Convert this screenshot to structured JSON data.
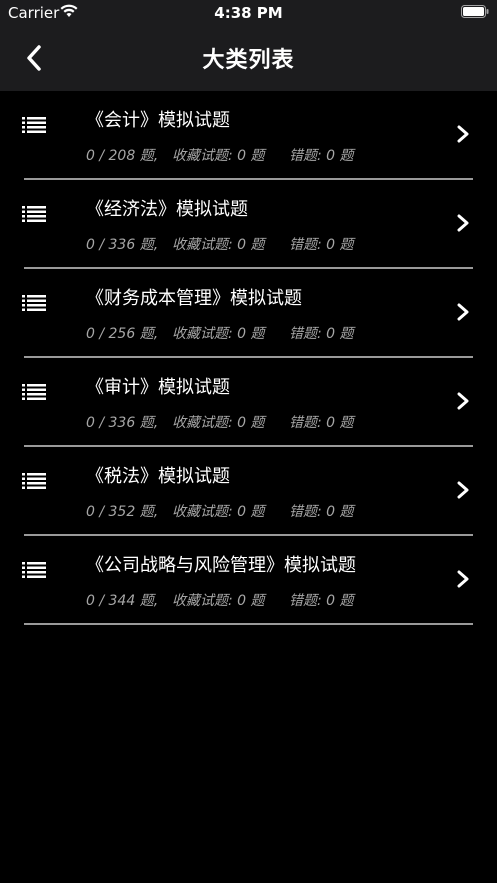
{
  "status_bar": {
    "carrier": "Carrier",
    "time": "4:38 PM"
  },
  "nav": {
    "title": "大类列表",
    "back_icon": "chevron-left-icon"
  },
  "colors": {
    "background": "#000000",
    "bar": "#1c1c1e",
    "meta_text": "#a6a6a6",
    "divider": "#9a9a9a"
  },
  "categories": [
    {
      "title": "《会计》模拟试题",
      "progress": "0 / 208 题,",
      "favorites": "收藏试题: 0 题",
      "errors": "错题: 0 题"
    },
    {
      "title": "《经济法》模拟试题",
      "progress": "0 / 336 题,",
      "favorites": "收藏试题: 0 题",
      "errors": "错题: 0 题"
    },
    {
      "title": "《财务成本管理》模拟试题",
      "progress": "0 / 256 题,",
      "favorites": "收藏试题: 0 题",
      "errors": "错题: 0 题"
    },
    {
      "title": "《审计》模拟试题",
      "progress": "0 / 336 题,",
      "favorites": "收藏试题: 0 题",
      "errors": "错题: 0 题"
    },
    {
      "title": "《税法》模拟试题",
      "progress": "0 / 352 题,",
      "favorites": "收藏试题: 0 题",
      "errors": "错题: 0 题"
    },
    {
      "title": "《公司战略与风险管理》模拟试题",
      "progress": "0 / 344 题,",
      "favorites": "收藏试题: 0 题",
      "errors": "错题: 0 题"
    }
  ]
}
